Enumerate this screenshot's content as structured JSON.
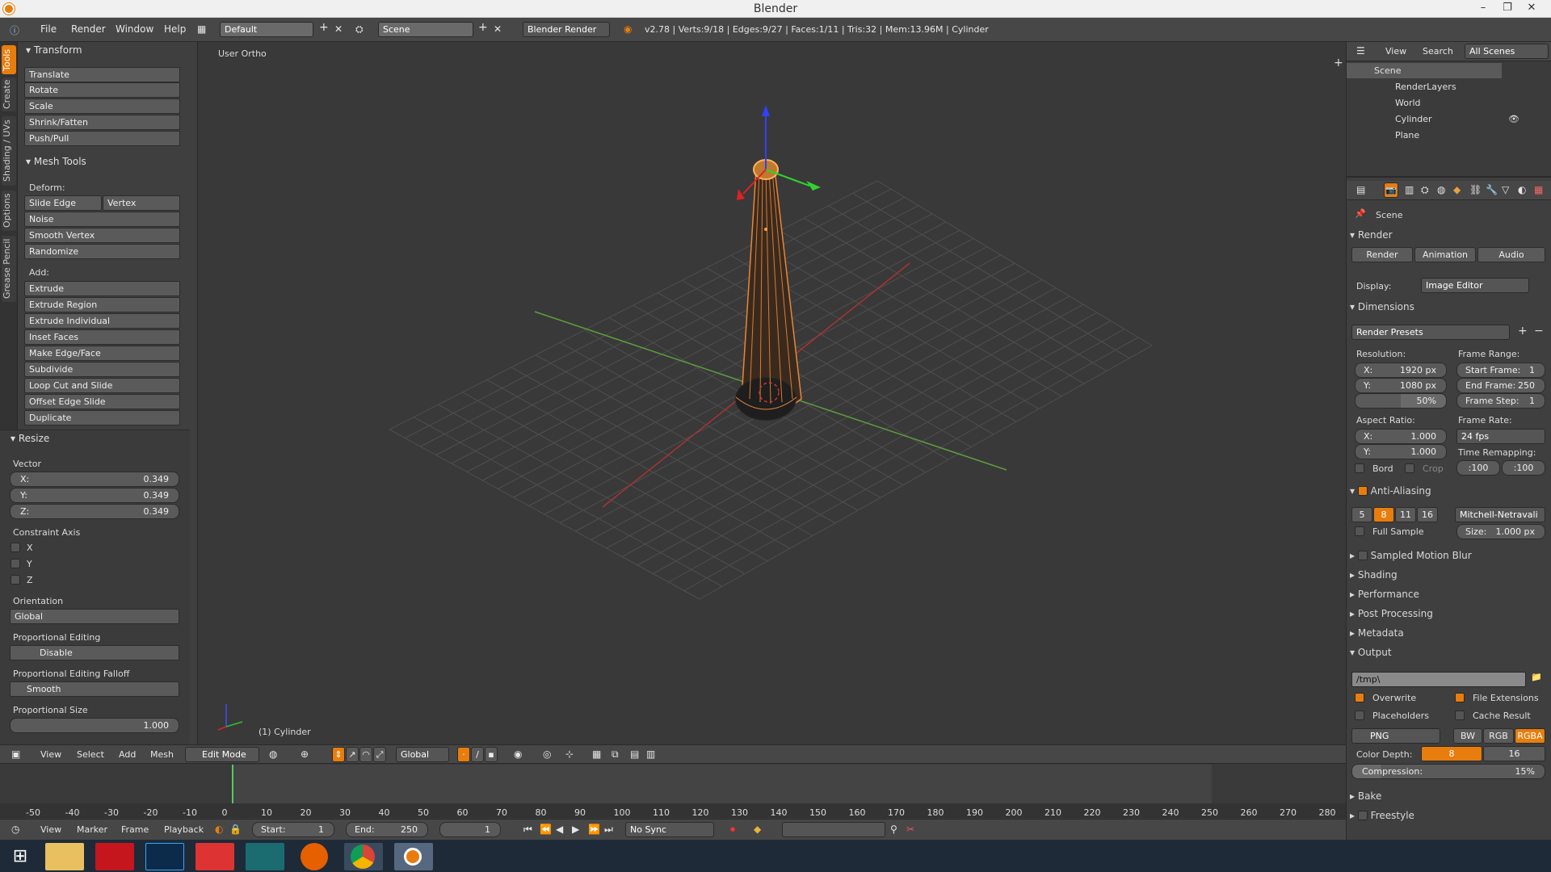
{
  "window": {
    "title": "Blender"
  },
  "menubar": {
    "menus": [
      "File",
      "Render",
      "Window",
      "Help"
    ],
    "layout": "Default",
    "scene": "Scene",
    "engine": "Blender Render",
    "stats": "v2.78 | Verts:9/18 | Edges:9/27 | Faces:1/11 | Tris:32 | Mem:13.96M | Cylinder"
  },
  "tabs": [
    "Tools",
    "Create",
    "Shading / UVs",
    "Options",
    "Grease Pencil"
  ],
  "tool_shelf": {
    "transform_title": "Transform",
    "transform_items": [
      "Translate",
      "Rotate",
      "Scale",
      "Shrink/Fatten",
      "Push/Pull"
    ],
    "mesh_tools_title": "Mesh Tools",
    "deform_label": "Deform:",
    "slide_edge": "Slide Edge",
    "vertex": "Vertex",
    "deform_items": [
      "Noise",
      "Smooth Vertex",
      "Randomize"
    ],
    "add_label": "Add:",
    "add_items": [
      "Extrude",
      "Extrude Region",
      "Extrude Individual",
      "Inset Faces",
      "Make Edge/Face",
      "Subdivide",
      "Loop Cut and Slide",
      "Offset Edge Slide",
      "Duplicate"
    ]
  },
  "operator": {
    "title": "Resize",
    "vector_label": "Vector",
    "x_label": "X:",
    "x_value": "0.349",
    "y_label": "Y:",
    "y_value": "0.349",
    "z_label": "Z:",
    "z_value": "0.349",
    "constraint_label": "Constraint Axis",
    "axes": [
      "X",
      "Y",
      "Z"
    ],
    "orientation_label": "Orientation",
    "orientation_value": "Global",
    "prop_edit_label": "Proportional Editing",
    "prop_edit_value": "Disable",
    "falloff_label": "Proportional Editing Falloff",
    "falloff_value": "Smooth",
    "prop_size_label": "Proportional Size",
    "prop_size_value": "1.000"
  },
  "viewport": {
    "view_name": "User Ortho",
    "object_label": "(1) Cylinder"
  },
  "view_header": {
    "menus": [
      "View",
      "Select",
      "Add",
      "Mesh"
    ],
    "mode": "Edit Mode",
    "orientation": "Global"
  },
  "timeline": {
    "ticks": [
      "-50",
      "-40",
      "-30",
      "-20",
      "-10",
      "0",
      "10",
      "20",
      "30",
      "40",
      "50",
      "60",
      "70",
      "80",
      "90",
      "100",
      "110",
      "120",
      "130",
      "140",
      "150",
      "160",
      "170",
      "180",
      "190",
      "200",
      "210",
      "220",
      "230",
      "240",
      "250",
      "260",
      "270",
      "280"
    ],
    "menus": [
      "View",
      "Marker",
      "Frame",
      "Playback"
    ],
    "start_label": "Start:",
    "start_value": "1",
    "end_label": "End:",
    "end_value": "250",
    "current": "1",
    "sync": "No Sync"
  },
  "outliner": {
    "menus": [
      "View",
      "Search"
    ],
    "filter": "All Scenes",
    "items": [
      "Scene",
      "RenderLayers",
      "World",
      "Cylinder",
      "Plane"
    ]
  },
  "properties": {
    "context": "Scene",
    "render_title": "Render",
    "render_btn": "Render",
    "animation_btn": "Animation",
    "audio_btn": "Audio",
    "display_label": "Display:",
    "display_value": "Image Editor",
    "dimensions_title": "Dimensions",
    "presets": "Render Presets",
    "resolution_label": "Resolution:",
    "res_x": "X:",
    "res_x_value": "1920 px",
    "res_y": "Y:",
    "res_y_value": "1080 px",
    "res_pct": "50%",
    "frame_range_label": "Frame Range:",
    "start_frame": "Start Frame:",
    "start_frame_value": "1",
    "end_frame": "End Frame:",
    "end_frame_value": "250",
    "frame_step": "Frame Step:",
    "frame_step_value": "1",
    "aspect_label": "Aspect Ratio:",
    "asp_x": "X:",
    "asp_x_value": "1.000",
    "asp_y": "Y:",
    "asp_y_value": "1.000",
    "frame_rate_label": "Frame Rate:",
    "frame_rate_value": "24 fps",
    "remap_label": "Time Remapping:",
    "remap_old": ":100",
    "remap_new": ":100",
    "bord": "Bord",
    "crop": "Crop",
    "aa_title": "Anti-Aliasing",
    "aa_samples": [
      "5",
      "8",
      "11",
      "16"
    ],
    "aa_filter": "Mitchell-Netravali",
    "full_sample": "Full Sample",
    "size_label": "Size:",
    "size_value": "1.000 px",
    "collapsed": [
      "Sampled Motion Blur",
      "Shading",
      "Performance",
      "Post Processing",
      "Metadata"
    ],
    "output_title": "Output",
    "output_path": "/tmp\\",
    "overwrite": "Overwrite",
    "file_ext": "File Extensions",
    "placeholders": "Placeholders",
    "cache_result": "Cache Result",
    "format": "PNG",
    "color_modes": [
      "BW",
      "RGB",
      "RGBA"
    ],
    "color_depth_label": "Color Depth:",
    "depth_values": [
      "8",
      "16"
    ],
    "compression_label": "Compression:",
    "compression_value": "15%",
    "bake_title": "Bake",
    "freestyle_title": "Freestyle"
  },
  "colors": {
    "accent": "#e87d0d",
    "panel": "#3f3f3f",
    "viewport": "#393939"
  }
}
